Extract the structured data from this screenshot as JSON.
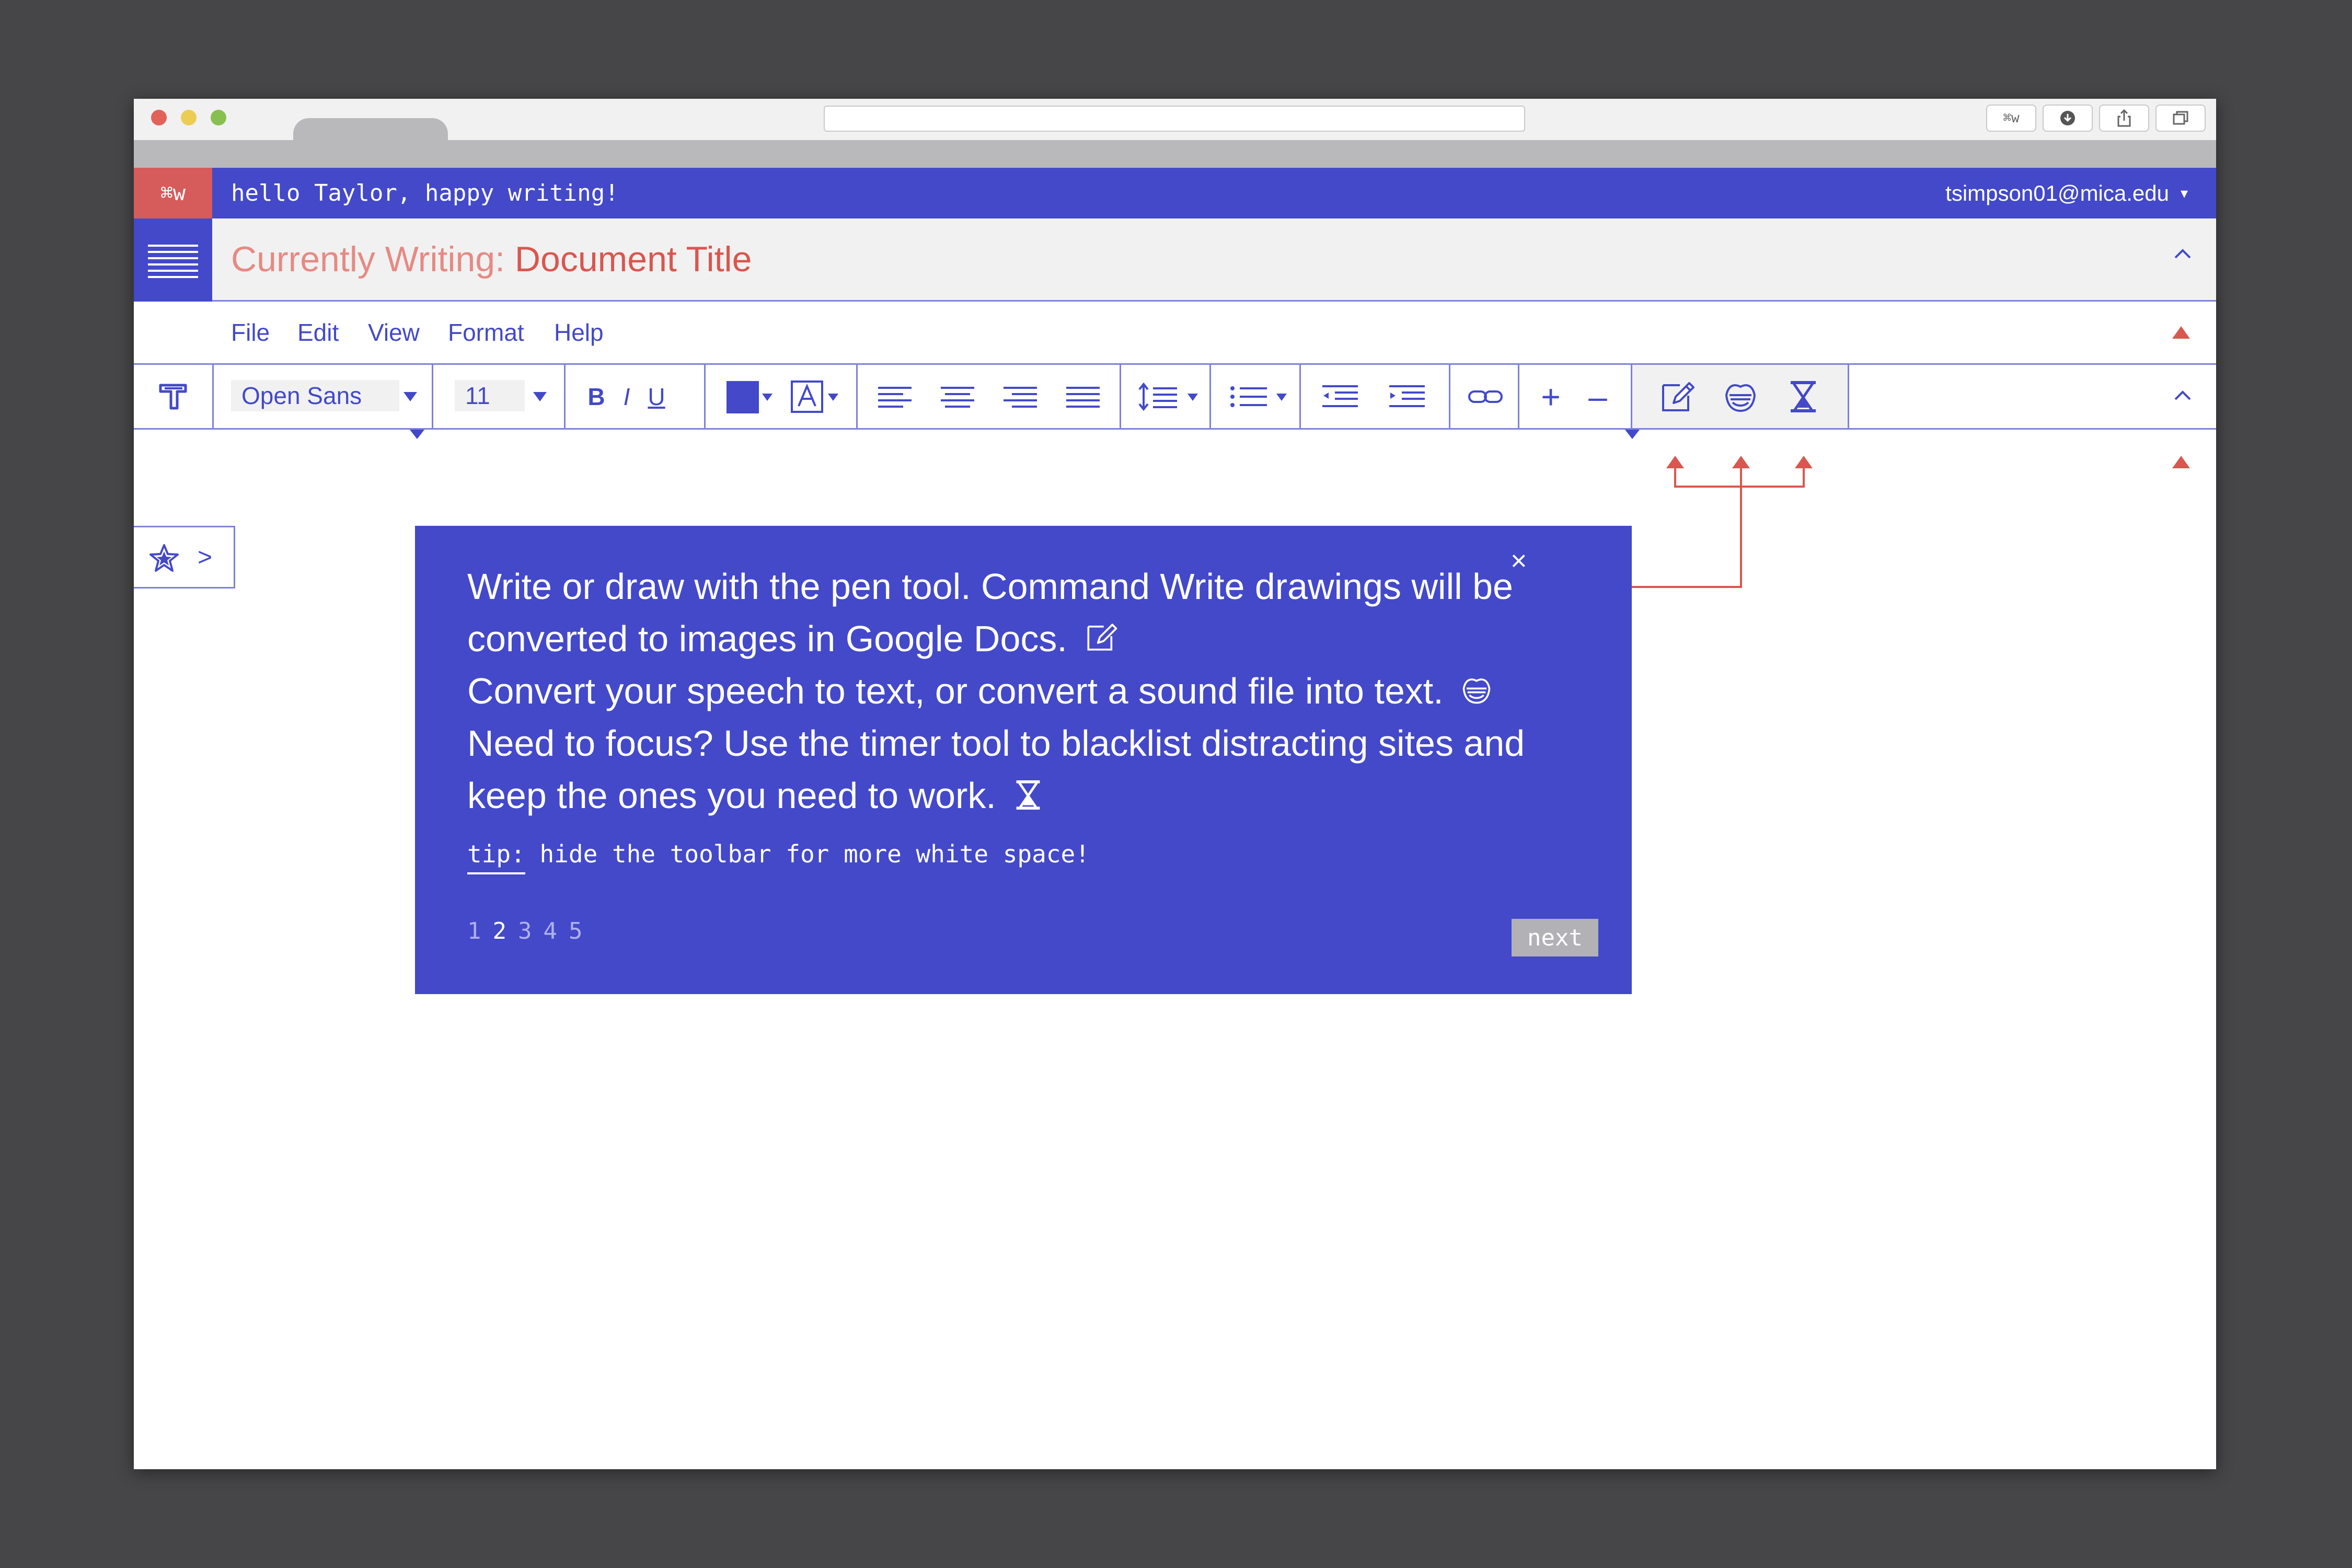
{
  "browser": {
    "buttons": [
      {
        "label": "⌘w"
      },
      {
        "label": ""
      },
      {
        "label": ""
      },
      {
        "label": ""
      }
    ]
  },
  "topbar": {
    "badge": "⌘w",
    "greeting": "hello Taylor, happy writing!",
    "email": "tsimpson01@mica.edu"
  },
  "docbar": {
    "label": "Currently Writing:",
    "title": "Document Title"
  },
  "menu": {
    "items": [
      "File",
      "Edit",
      "View",
      "Format",
      "Help"
    ]
  },
  "toolbar": {
    "font": "Open Sans",
    "size": "11",
    "bold": "B",
    "italic": "I",
    "underline": "U",
    "zoom_in": "+",
    "zoom_out": "–"
  },
  "popup": {
    "line1": "Write or draw with the pen tool. Command Write drawings will be converted to images in Google Docs.",
    "line2": "Convert your speech to text, or convert a sound file into text.",
    "line3": "Need to focus? Use the timer tool to blacklist distracting sites and keep the ones you need to work.",
    "tip_key": "tip:",
    "tip_text": "hide the toolbar for more white space!",
    "pages": [
      "1",
      "2",
      "3",
      "4",
      "5"
    ],
    "active_page": "2",
    "next_label": "next",
    "close_label": "×"
  },
  "sidebar": {
    "expand_label": ">"
  },
  "colors": {
    "accent": "#4349c9",
    "brand_red": "#d9574f",
    "light_red": "#e58a84",
    "panel": "#f1f1f1",
    "background": "#464648"
  }
}
